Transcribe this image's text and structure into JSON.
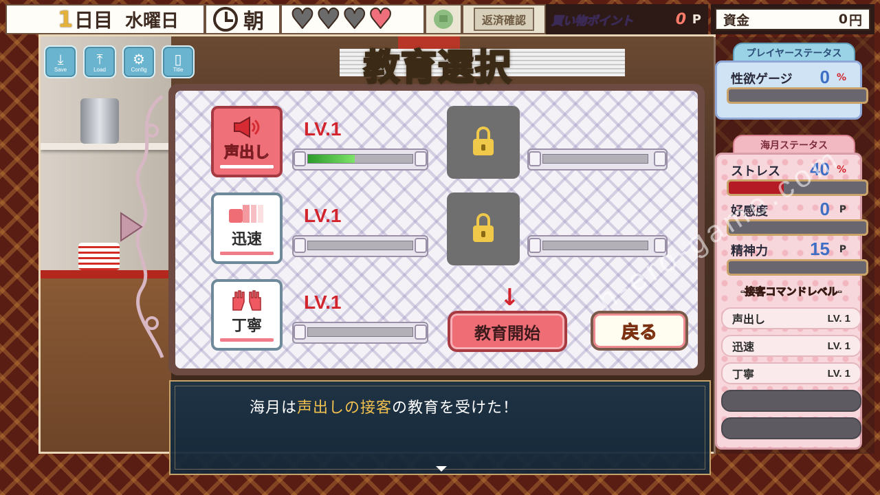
{
  "topbar": {
    "day_number": "1",
    "day_suffix": "日目",
    "weekday": "水曜日",
    "time_of_day": "朝",
    "hearts": [
      false,
      false,
      false,
      true
    ],
    "repay_label": "返済確認",
    "points_label": "買い物ポイント",
    "points_value": "0",
    "points_unit": "P",
    "funds_label": "資金",
    "funds_value": "0",
    "funds_unit": "円"
  },
  "system_buttons": [
    {
      "label": "Save",
      "icon": "save-icon"
    },
    {
      "label": "Load",
      "icon": "load-icon"
    },
    {
      "label": "Config",
      "icon": "gear-icon"
    },
    {
      "label": "Title",
      "icon": "door-icon"
    }
  ],
  "dialog": {
    "title": "教育選択",
    "skills": [
      {
        "name": "声出し",
        "level": "LV.1",
        "progress": 0.45,
        "selected": true,
        "icon": "megaphone-icon"
      },
      {
        "name": "迅速",
        "level": "LV.1",
        "progress": 0,
        "selected": false,
        "icon": "speed-icon"
      },
      {
        "name": "丁寧",
        "level": "LV.1",
        "progress": 0,
        "selected": false,
        "icon": "hands-icon"
      }
    ],
    "locked_slots": 2,
    "start_button": "教育開始",
    "back_button": "戻る"
  },
  "message": {
    "prefix": "海月は",
    "highlight": "声出しの接客",
    "suffix": "の教育を受けた！"
  },
  "player_status": {
    "header": "プレイヤーステータス",
    "libido_label": "性欲ゲージ",
    "libido_value": "0",
    "libido_unit": "%"
  },
  "character_status": {
    "header": "海月ステータス",
    "stress_label": "ストレス",
    "stress_value": "40",
    "stress_unit": "%",
    "stress_level": 0.4,
    "affection_label": "好感度",
    "affection_value": "0",
    "affection_unit": "P",
    "mental_label": "精神力",
    "mental_value": "15",
    "mental_unit": "P",
    "cmd_header": "-接客コマンドレベル-",
    "commands": [
      {
        "name": "声出し",
        "level": "LV. 1"
      },
      {
        "name": "迅速",
        "level": "LV. 1"
      },
      {
        "name": "丁寧",
        "level": "LV. 1"
      }
    ]
  },
  "watermark": "h-ero-game.com",
  "colors": {
    "accent_red": "#d2242c",
    "progress_green": "#5fd04e",
    "stress_red": "#b51b24",
    "value_blue": "#3f6fc4"
  }
}
